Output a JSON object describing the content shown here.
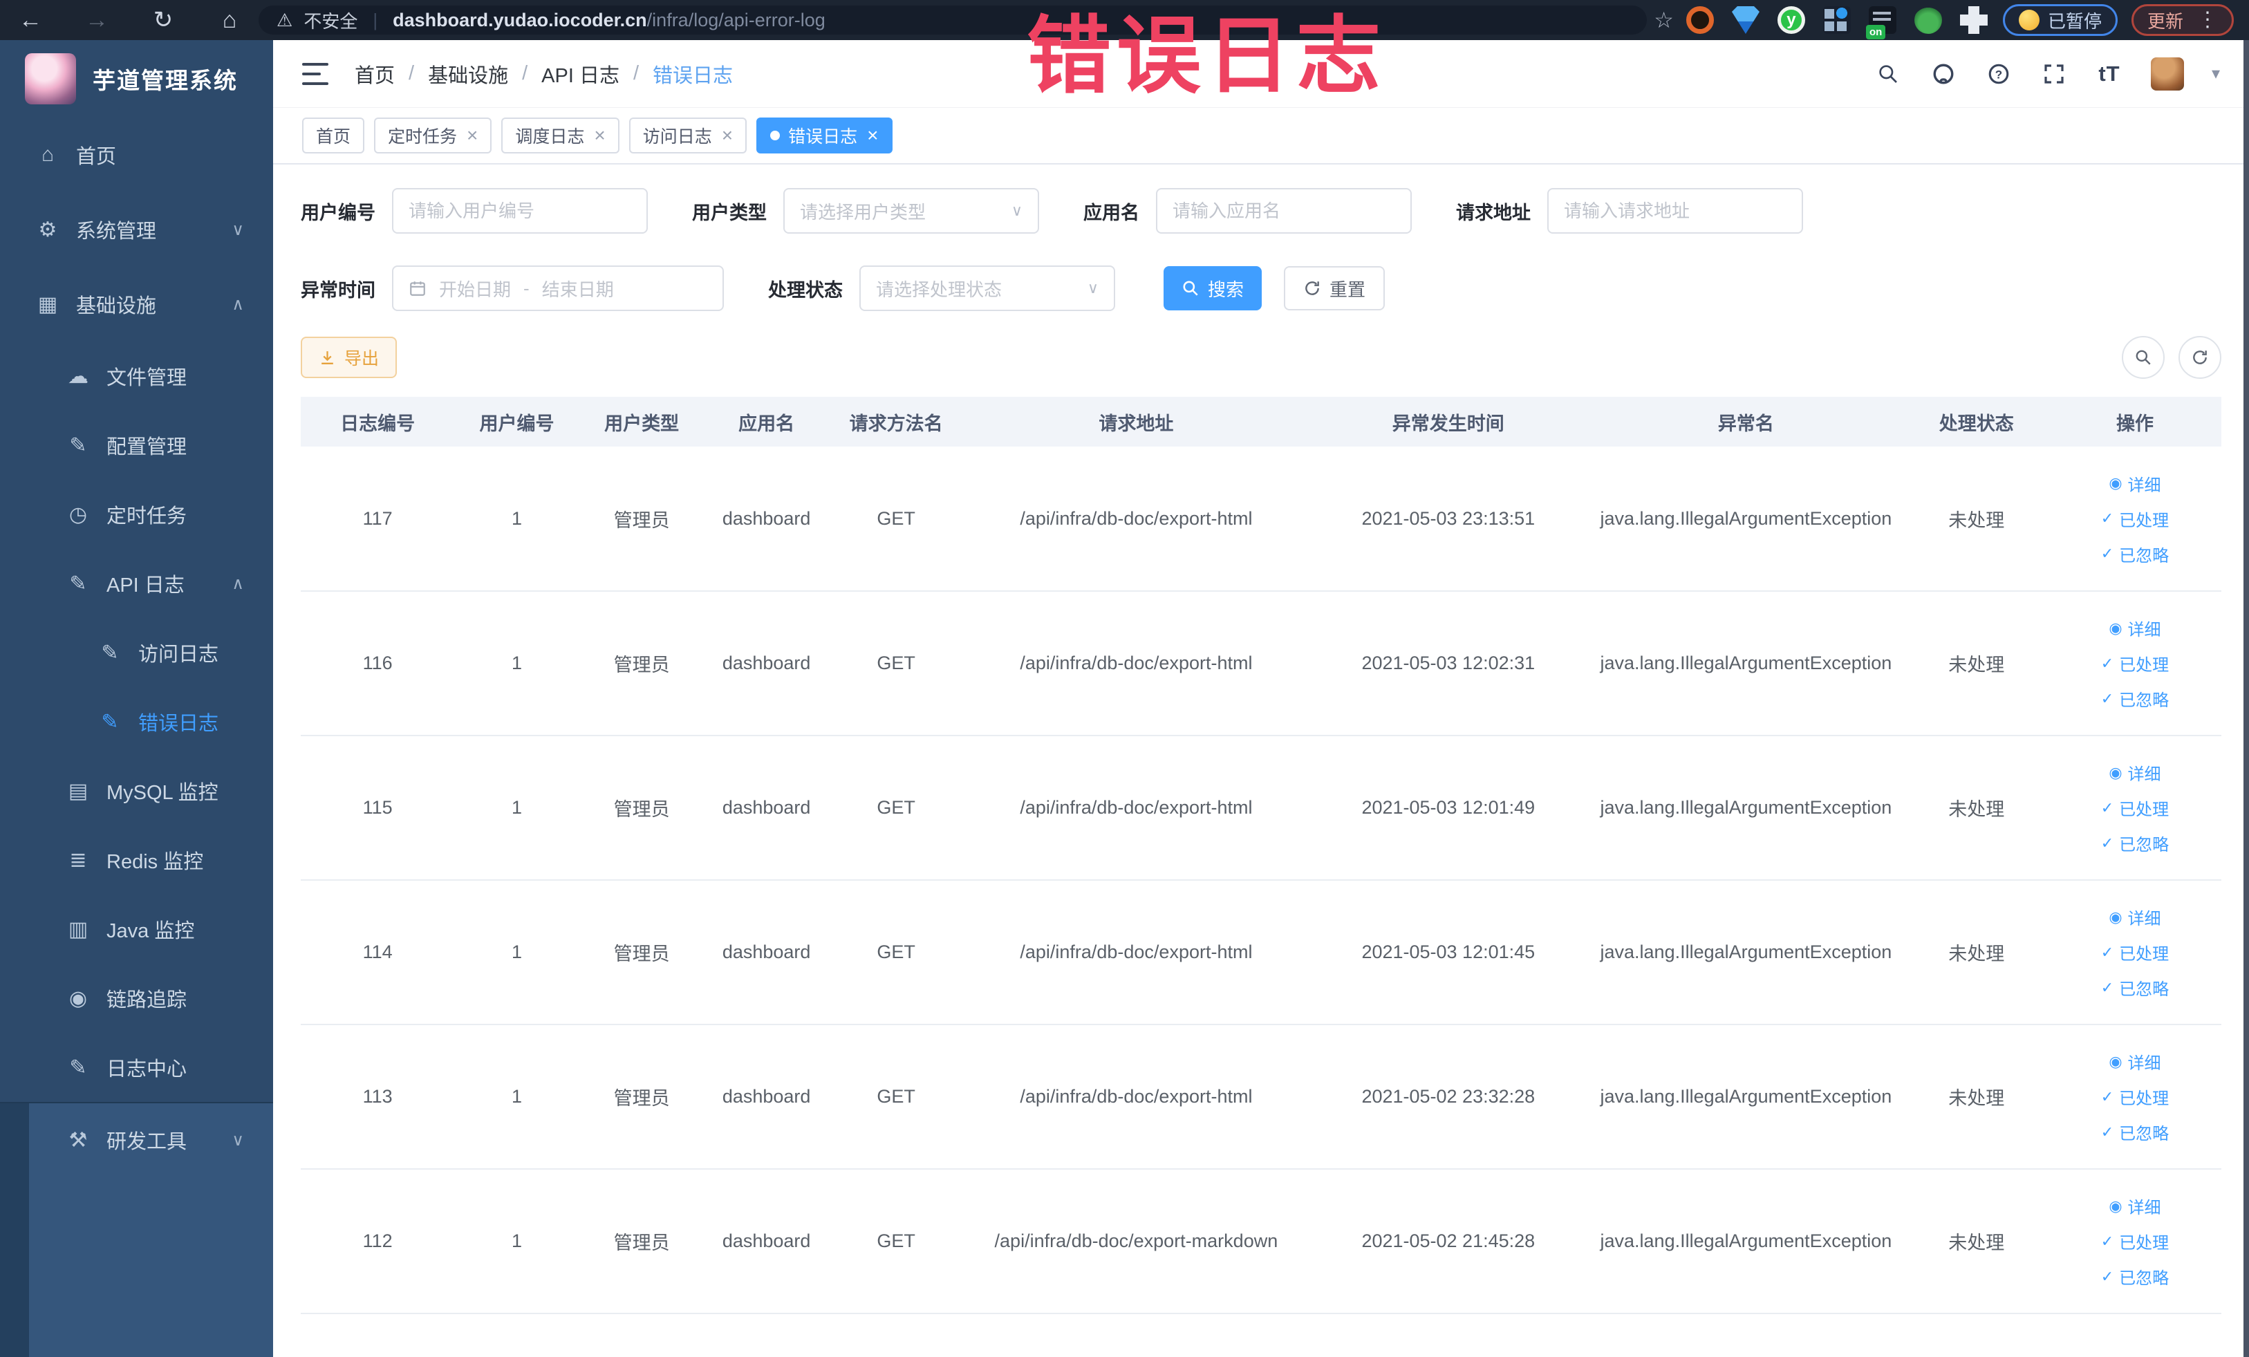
{
  "browser": {
    "security_label": "不安全",
    "url_domain": "dashboard.yudao.iocoder.cn",
    "url_path": "/infra/log/api-error-log",
    "extension_badge": "on",
    "paused_badge": "已暂停",
    "update_label": "更新"
  },
  "annotation": "错误日志",
  "sidebar": {
    "app_title": "芋道管理系统",
    "items": [
      {
        "label": "首页",
        "icon": "home",
        "level": 1
      },
      {
        "label": "系统管理",
        "icon": "gear",
        "level": 1,
        "arrow": "down"
      },
      {
        "label": "基础设施",
        "icon": "infra",
        "level": 1,
        "arrow": "up"
      },
      {
        "label": "文件管理",
        "icon": "cloud-upload",
        "level": 2
      },
      {
        "label": "配置管理",
        "icon": "edit",
        "level": 2
      },
      {
        "label": "定时任务",
        "icon": "timer",
        "level": 2
      },
      {
        "label": "API 日志",
        "icon": "log",
        "level": 2,
        "arrow": "up"
      },
      {
        "label": "访问日志",
        "icon": "log",
        "level": 3
      },
      {
        "label": "错误日志",
        "icon": "log",
        "level": 3,
        "active": true
      },
      {
        "label": "MySQL 监控",
        "icon": "mysql",
        "level": 2
      },
      {
        "label": "Redis 监控",
        "icon": "redis",
        "level": 2
      },
      {
        "label": "Java 监控",
        "icon": "java",
        "level": 2
      },
      {
        "label": "链路追踪",
        "icon": "trace",
        "level": 2
      },
      {
        "label": "日志中心",
        "icon": "log",
        "level": 2
      },
      {
        "label": "研发工具",
        "icon": "tools",
        "level": 1,
        "arrow": "down",
        "section": "light"
      }
    ]
  },
  "header": {
    "breadcrumb": [
      {
        "label": "首页"
      },
      {
        "label": "基础设施"
      },
      {
        "label": "API 日志"
      },
      {
        "label": "错误日志",
        "active": true
      }
    ]
  },
  "tabs": [
    {
      "label": "首页",
      "closable": false
    },
    {
      "label": "定时任务",
      "closable": true
    },
    {
      "label": "调度日志",
      "closable": true
    },
    {
      "label": "访问日志",
      "closable": true
    },
    {
      "label": "错误日志",
      "closable": true,
      "active": true
    }
  ],
  "filters": {
    "user_id": {
      "label": "用户编号",
      "placeholder": "请输入用户编号"
    },
    "user_type": {
      "label": "用户类型",
      "placeholder": "请选择用户类型"
    },
    "app_name": {
      "label": "应用名",
      "placeholder": "请输入应用名"
    },
    "request_url": {
      "label": "请求地址",
      "placeholder": "请输入请求地址"
    },
    "exception_time": {
      "label": "异常时间",
      "start_placeholder": "开始日期",
      "separator": "-",
      "end_placeholder": "结束日期"
    },
    "process_status": {
      "label": "处理状态",
      "placeholder": "请选择处理状态"
    },
    "search_label": "搜索",
    "reset_label": "重置"
  },
  "toolbar": {
    "export_label": "导出"
  },
  "table": {
    "columns": [
      {
        "label": "日志编号"
      },
      {
        "label": "用户编号"
      },
      {
        "label": "用户类型"
      },
      {
        "label": "应用名"
      },
      {
        "label": "请求方法名"
      },
      {
        "label": "请求地址"
      },
      {
        "label": "异常发生时间"
      },
      {
        "label": "异常名"
      },
      {
        "label": "处理状态"
      },
      {
        "label": "操作"
      }
    ],
    "actions": [
      {
        "label": "详细",
        "icon": "eye"
      },
      {
        "label": "已处理",
        "icon": "check"
      },
      {
        "label": "已忽略",
        "icon": "check"
      }
    ],
    "rows": [
      {
        "id": "117",
        "user_id": "1",
        "user_type": "管理员",
        "app": "dashboard",
        "method": "GET",
        "url": "/api/infra/db-doc/export-html",
        "time": "2021-05-03 23:13:51",
        "exception": "java.lang.IllegalArgumentException",
        "status": "未处理"
      },
      {
        "id": "116",
        "user_id": "1",
        "user_type": "管理员",
        "app": "dashboard",
        "method": "GET",
        "url": "/api/infra/db-doc/export-html",
        "time": "2021-05-03 12:02:31",
        "exception": "java.lang.IllegalArgumentException",
        "status": "未处理"
      },
      {
        "id": "115",
        "user_id": "1",
        "user_type": "管理员",
        "app": "dashboard",
        "method": "GET",
        "url": "/api/infra/db-doc/export-html",
        "time": "2021-05-03 12:01:49",
        "exception": "java.lang.IllegalArgumentException",
        "status": "未处理"
      },
      {
        "id": "114",
        "user_id": "1",
        "user_type": "管理员",
        "app": "dashboard",
        "method": "GET",
        "url": "/api/infra/db-doc/export-html",
        "time": "2021-05-03 12:01:45",
        "exception": "java.lang.IllegalArgumentException",
        "status": "未处理"
      },
      {
        "id": "113",
        "user_id": "1",
        "user_type": "管理员",
        "app": "dashboard",
        "method": "GET",
        "url": "/api/infra/db-doc/export-html",
        "time": "2021-05-02 23:32:28",
        "exception": "java.lang.IllegalArgumentException",
        "status": "未处理"
      },
      {
        "id": "112",
        "user_id": "1",
        "user_type": "管理员",
        "app": "dashboard",
        "method": "GET",
        "url": "/api/infra/db-doc/export-markdown",
        "time": "2021-05-02 21:45:28",
        "exception": "java.lang.IllegalArgumentException",
        "status": "未处理"
      }
    ]
  },
  "icons": {
    "home": "⌂",
    "gear": "⚙",
    "infra": "▦",
    "cloud-upload": "☁",
    "edit": "✎",
    "timer": "◷",
    "log": "✎",
    "mysql": "▤",
    "redis": "≣",
    "java": "▥",
    "trace": "◉",
    "tools": "⚒",
    "eye": "◉",
    "check": "✓"
  },
  "colors": {
    "primary": "#409eff",
    "warning": "#e6a23c",
    "annotation": "#ee4261",
    "sidebar_bg": "#2d4a6b",
    "topbar_bg": "#1c2532"
  }
}
